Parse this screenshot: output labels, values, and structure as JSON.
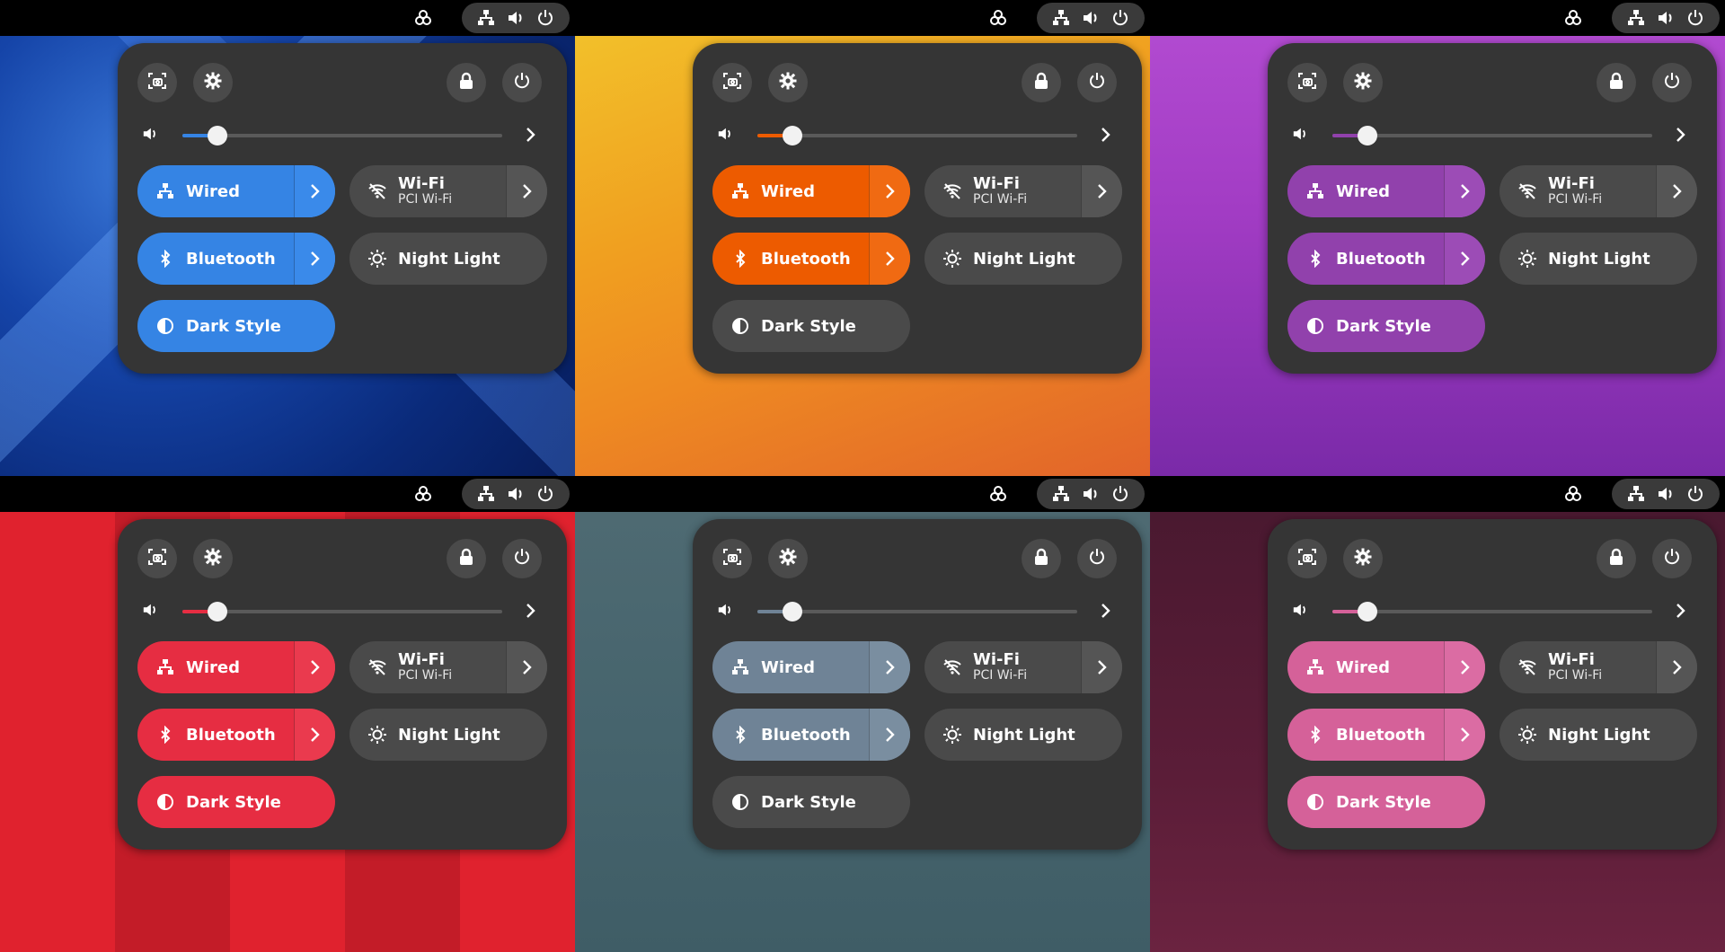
{
  "top_bar": {
    "activities_icon": "activities-icon",
    "status_icons": [
      "wired-network-icon",
      "volume-icon",
      "power-icon"
    ]
  },
  "quick_settings": {
    "header_buttons": [
      "screenshot-icon",
      "settings-icon",
      "lock-icon",
      "power-icon"
    ],
    "volume": {
      "icon": "speaker-icon",
      "level": 0.11
    },
    "toggles": {
      "wired": {
        "label": "Wired"
      },
      "wifi": {
        "label": "Wi-Fi",
        "sublabel": "PCI Wi-Fi"
      },
      "bluetooth": {
        "label": "Bluetooth"
      },
      "night_light": {
        "label": "Night Light"
      },
      "dark_style": {
        "label": "Dark Style"
      }
    }
  },
  "variants": [
    {
      "name": "blue",
      "accent": "#3584e4",
      "arrow_bg": "#3a8aea",
      "dark_style_on": true
    },
    {
      "name": "orange",
      "accent": "#ed5b00",
      "arrow_bg": "#f06a12",
      "dark_style_on": false
    },
    {
      "name": "purple",
      "accent": "#9141ac",
      "arrow_bg": "#9c4cb6",
      "dark_style_on": true
    },
    {
      "name": "red",
      "accent": "#e62d42",
      "arrow_bg": "#ea3a4e",
      "dark_style_on": true
    },
    {
      "name": "slate",
      "accent": "#6f8396",
      "arrow_bg": "#7a8ea0",
      "dark_style_on": false
    },
    {
      "name": "pink",
      "accent": "#d56199",
      "arrow_bg": "#db6ca3",
      "dark_style_on": true
    }
  ]
}
